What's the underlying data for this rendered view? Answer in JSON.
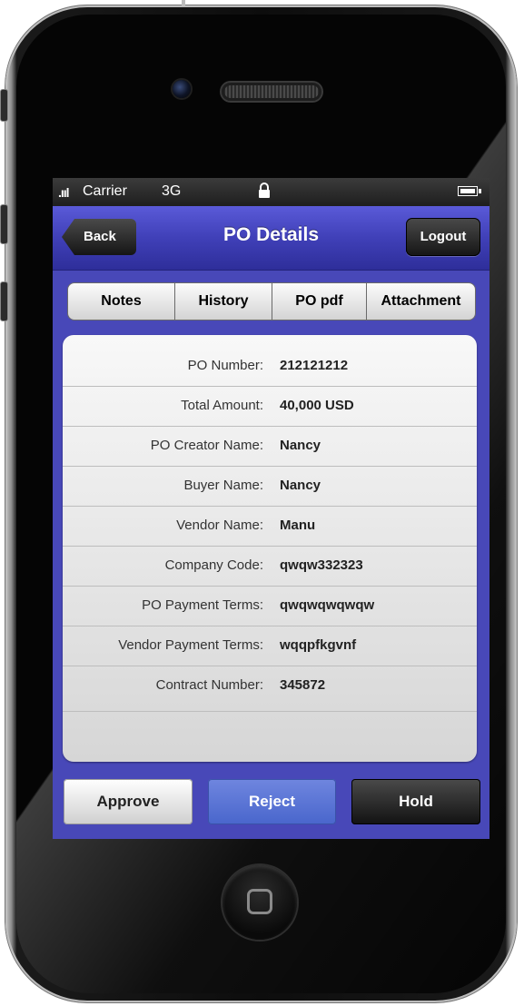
{
  "status_bar": {
    "signal": ".ııl",
    "carrier": "Carrier",
    "network": "3G"
  },
  "nav": {
    "back_label": "Back",
    "title": "PO Details",
    "logout_label": "Logout"
  },
  "tabs": [
    {
      "label": "Notes"
    },
    {
      "label": "History"
    },
    {
      "label": "PO pdf"
    },
    {
      "label": "Attachment"
    }
  ],
  "details": [
    {
      "label": "PO Number:",
      "value": "212121212"
    },
    {
      "label": "Total Amount:",
      "value": "40,000 USD"
    },
    {
      "label": "PO Creator Name:",
      "value": "Nancy"
    },
    {
      "label": "Buyer Name:",
      "value": "Nancy"
    },
    {
      "label": "Vendor Name:",
      "value": "Manu"
    },
    {
      "label": "Company Code:",
      "value": "qwqw332323"
    },
    {
      "label": "PO Payment Terms:",
      "value": "qwqwqwqwqw"
    },
    {
      "label": "Vendor Payment Terms:",
      "value": "wqqpfkgvnf"
    },
    {
      "label": "Contract Number:",
      "value": "345872"
    }
  ],
  "actions": {
    "approve_label": "Approve",
    "reject_label": "Reject",
    "hold_label": "Hold"
  },
  "colors": {
    "nav_blue": "#4444bb",
    "reject_blue": "#5b74d6",
    "hold_black": "#1f1f1f"
  }
}
